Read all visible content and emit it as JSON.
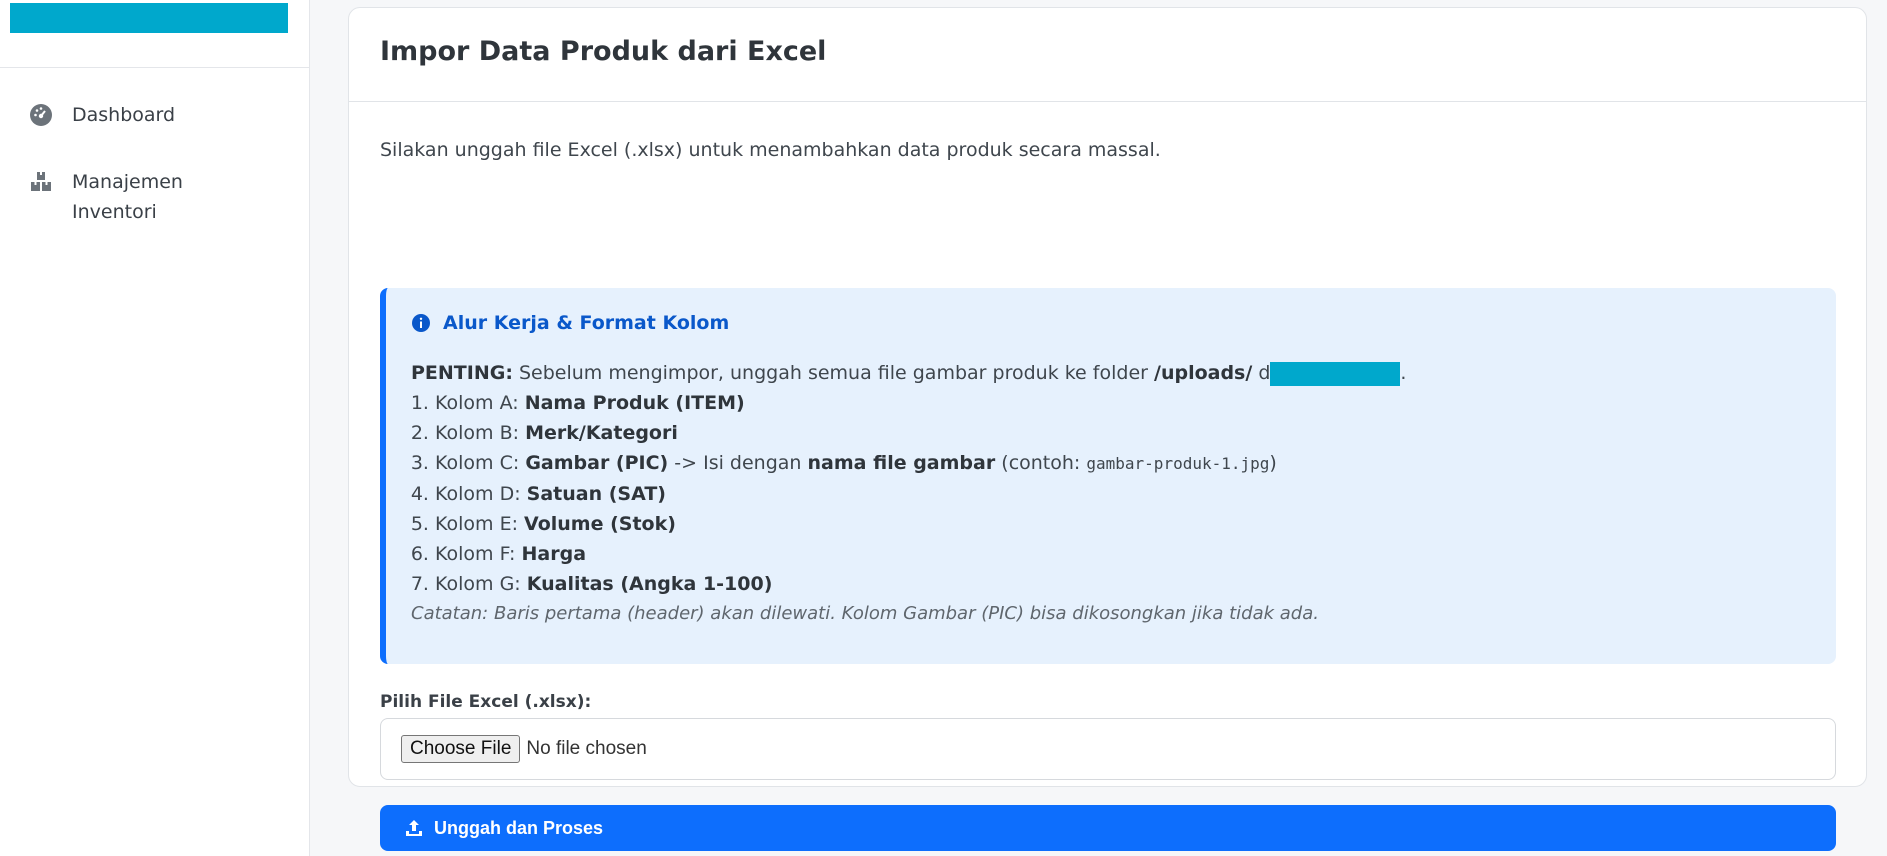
{
  "sidebar": {
    "items": [
      {
        "label": "Dashboard",
        "icon": "dashboard-gauge-icon"
      },
      {
        "label": "Manajemen Inventori",
        "icon": "boxes-icon"
      }
    ]
  },
  "page": {
    "title": "Impor Data Produk dari Excel",
    "intro": "Silakan unggah file Excel (.xlsx) untuk menambahkan data produk secara massal."
  },
  "info": {
    "title": "Alur Kerja & Format Kolom",
    "important_label": "PENTING:",
    "important_text": "Sebelum mengimpor, unggah semua file gambar produk ke folder",
    "folder": "/uploads/",
    "folder_suffix": "d",
    "columns": [
      {
        "prefix": "Kolom A:",
        "name": "Nama Produk (ITEM)"
      },
      {
        "prefix": "Kolom B:",
        "name": "Merk/Kategori"
      },
      {
        "prefix": "Kolom C:",
        "name": "Gambar (PIC)",
        "extra_pre": "-> Isi dengan",
        "extra_bold": "nama file gambar",
        "example_pre": "(contoh:",
        "example_code": "gambar-produk-1.jpg",
        "example_post": ")"
      },
      {
        "prefix": "Kolom D:",
        "name": "Satuan (SAT)"
      },
      {
        "prefix": "Kolom E:",
        "name": "Volume (Stok)"
      },
      {
        "prefix": "Kolom F:",
        "name": "Harga"
      },
      {
        "prefix": "Kolom G:",
        "name": "Kualitas (Angka 1-100)"
      }
    ],
    "note": "Catatan: Baris pertama (header) akan dilewati. Kolom Gambar (PIC) bisa dikosongkan jika tidak ada."
  },
  "form": {
    "file_label": "Pilih File Excel (.xlsx):",
    "choose_button": "Choose File",
    "no_file": "No file chosen",
    "submit_label": "Unggah dan Proses"
  },
  "colors": {
    "accent": "#0d6efd",
    "brand": "#00a8cc",
    "info_bg": "#e6f1fd"
  }
}
